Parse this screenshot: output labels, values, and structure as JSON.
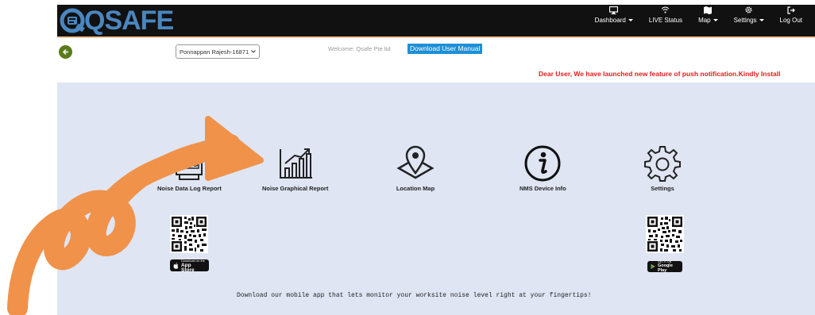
{
  "app": {
    "logo_text": "QSAFE"
  },
  "nav": {
    "items": [
      {
        "label": "Dashboard",
        "icon": "monitor-icon",
        "caret": true
      },
      {
        "label": "LIVE Status",
        "icon": "wifi-icon",
        "caret": false
      },
      {
        "label": "Map",
        "icon": "map-icon",
        "caret": true
      },
      {
        "label": "Settings",
        "icon": "gear-icon",
        "caret": true
      },
      {
        "label": "Log Out",
        "icon": "logout-icon",
        "caret": false
      }
    ]
  },
  "subheader": {
    "user_selected": "Ponnappan Rajesh-16871",
    "welcome_text": "Welcome: Qsafe Pte ltd",
    "manual_button": "Download User Manual",
    "ticker_text": "Dear User, We have launched new feature of push notification.Kindly Install"
  },
  "tiles": [
    {
      "label": "Noise Data Log Report",
      "icon": "log-icon"
    },
    {
      "label": "Noise Graphical Report",
      "icon": "bar-chart-icon"
    },
    {
      "label": "Location Map",
      "icon": "map-pin-icon"
    },
    {
      "label": "NMS Device Info",
      "icon": "info-icon"
    },
    {
      "label": "Settings",
      "icon": "gear-icon"
    }
  ],
  "apps": {
    "appstore_small": "Download on the",
    "appstore_big": "App Store",
    "googleplay_small": "GET IT ON",
    "googleplay_big": "Google Play"
  },
  "footer_note": "Download our mobile app that lets monitor your worksite noise level right at your fingertips!",
  "colors": {
    "nav_bg": "#111111",
    "logo": "#4a86bf",
    "panel_bg": "#dfe5f3",
    "ticker": "#e41b1b",
    "manual_button": "#1e8fd6",
    "overlay_arrow": "#f0924a"
  }
}
